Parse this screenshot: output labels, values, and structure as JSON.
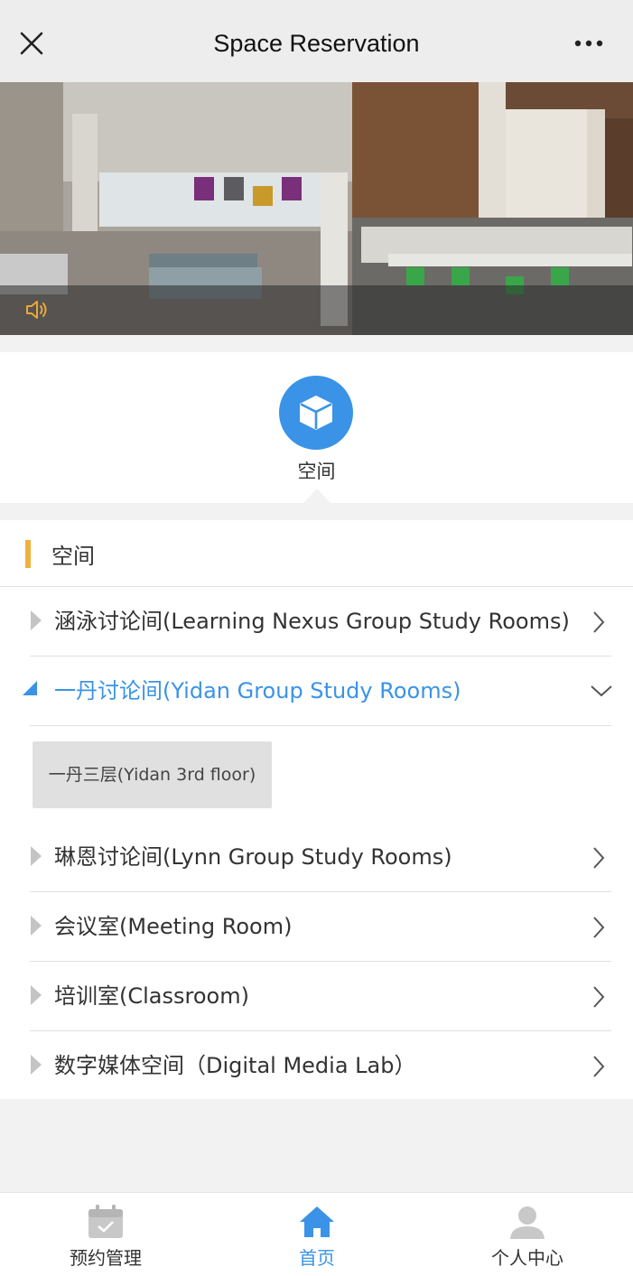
{
  "header": {
    "title": "Space Reservation",
    "close_icon": "close-icon",
    "more_icon": "more-horizontal-icon"
  },
  "banner": {
    "speaker_icon": "speaker-icon"
  },
  "categories": [
    {
      "label": "空间",
      "icon": "cube-icon",
      "color": "#3a93e6",
      "selected": true
    }
  ],
  "section": {
    "title": "空间",
    "accent_color": "#f0b13c"
  },
  "list": {
    "items": [
      {
        "label": "涵泳讨论间(Learning Nexus Group Study Rooms)",
        "expanded": false
      },
      {
        "label": "一丹讨论间(Yidan Group Study Rooms)",
        "expanded": true,
        "children": [
          "一丹三层(Yidan 3rd floor)"
        ]
      },
      {
        "label": "琳恩讨论间(Lynn Group Study Rooms)",
        "expanded": false
      },
      {
        "label": "会议室(Meeting Room)",
        "expanded": false
      },
      {
        "label": "培训室(Classroom)",
        "expanded": false
      },
      {
        "label": "数字媒体空间（Digital Media Lab）",
        "expanded": false
      }
    ]
  },
  "bottom_nav": {
    "items": [
      {
        "label": "预约管理",
        "icon": "calendar-check-icon",
        "active": false
      },
      {
        "label": "首页",
        "icon": "home-icon",
        "active": true
      },
      {
        "label": "个人中心",
        "icon": "user-icon",
        "active": false
      }
    ],
    "active_color": "#3a93e6"
  }
}
